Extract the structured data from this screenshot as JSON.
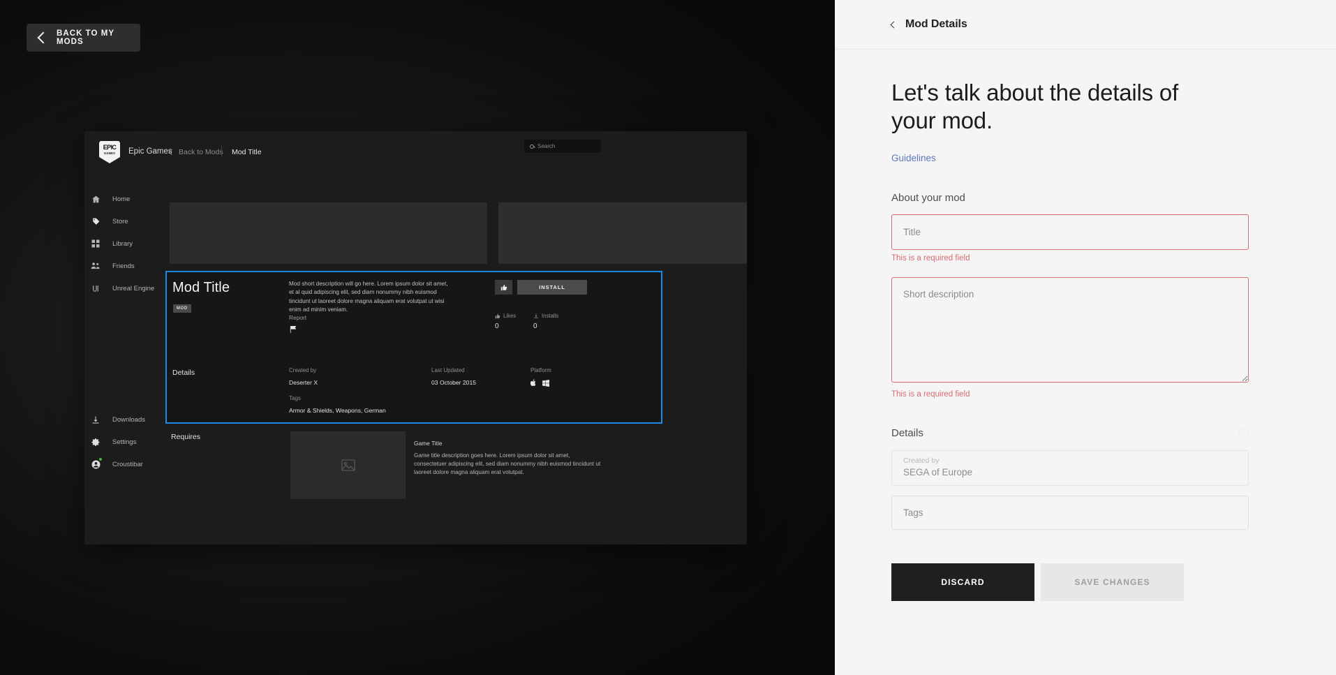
{
  "back_button": {
    "label": "BACK TO MY MODS",
    "icon": "chevron-left-icon"
  },
  "preview": {
    "app_name": "Epic Games",
    "breadcrumb_back": "Back to Mods",
    "breadcrumb_current": "Mod Title",
    "search_placeholder": "Search",
    "sidebar": [
      {
        "label": "Home",
        "icon": "home-icon"
      },
      {
        "label": "Store",
        "icon": "tag-icon"
      },
      {
        "label": "Library",
        "icon": "grid-icon"
      },
      {
        "label": "Friends",
        "icon": "people-icon"
      },
      {
        "label": "Unreal Engine",
        "icon": "unreal-icon"
      },
      {
        "label": "Downloads",
        "icon": "download-icon"
      },
      {
        "label": "Settings",
        "icon": "gear-icon"
      },
      {
        "label": "Croustibar",
        "icon": "account-icon"
      }
    ],
    "mod": {
      "title": "Mod Title",
      "badge": "MOD",
      "description": "Mod short description will go here. Lorem ipsum dolor sit amet, et al quid adipiscing elit, sed diam nonummy nibh euismod tincidunt ut laoreet dolore magna aliquam erat volutpat ut wisi enim ad minim veniam.",
      "report_label": "Report",
      "like_icon": "thumbs-up-icon",
      "install_label": "INSTALL",
      "stats": [
        {
          "label": "Likes",
          "value": "0",
          "icon": "thumbs-up-icon"
        },
        {
          "label": "Installs",
          "value": "0",
          "icon": "download-icon"
        }
      ],
      "details_label": "Details",
      "created_by_label": "Created by",
      "created_by_value": "Deserter X",
      "last_updated_label": "Last Updated",
      "last_updated_value": "03 October 2015",
      "platform_label": "Platform",
      "platforms": [
        "apple-icon",
        "windows-icon"
      ],
      "tags_label": "Tags",
      "tags_value": "Armor & Shields, Weapons, German"
    },
    "requires": {
      "label": "Requires",
      "game_title": "Game Title",
      "game_description": "Game title description goes here. Lorem ipsum dolor sit amet, consectetuer adipiscing elit, sed diam nonummy nibh euismod tincidunt ut laoreet dolore magna aliquam erat volutpat.",
      "thumb_icon": "image-placeholder-icon"
    }
  },
  "panel": {
    "header_title": "Mod Details",
    "header_back_icon": "chevron-left-icon",
    "heading": "Let's talk about the details of your mod.",
    "guidelines_link": "Guidelines",
    "about_section_label": "About your mod",
    "title_placeholder": "Title",
    "title_value": "",
    "title_error": "This is a required field",
    "description_placeholder": "Short description",
    "description_value": "",
    "description_error": "This is a required field",
    "details_section_label": "Details",
    "details_info_icon": "info-icon",
    "created_by_label": "Created by",
    "created_by_value": "SEGA of Europe",
    "tags_placeholder": "Tags",
    "tags_value": "",
    "discard_label": "DISCARD",
    "save_label": "SAVE CHANGES"
  },
  "colors": {
    "accent_blue": "#1e88e5",
    "error_red": "#d96b72",
    "link_blue": "#5b78bd",
    "panel_bg": "#f5f5f5",
    "dark_bg": "#1c1c1c"
  }
}
